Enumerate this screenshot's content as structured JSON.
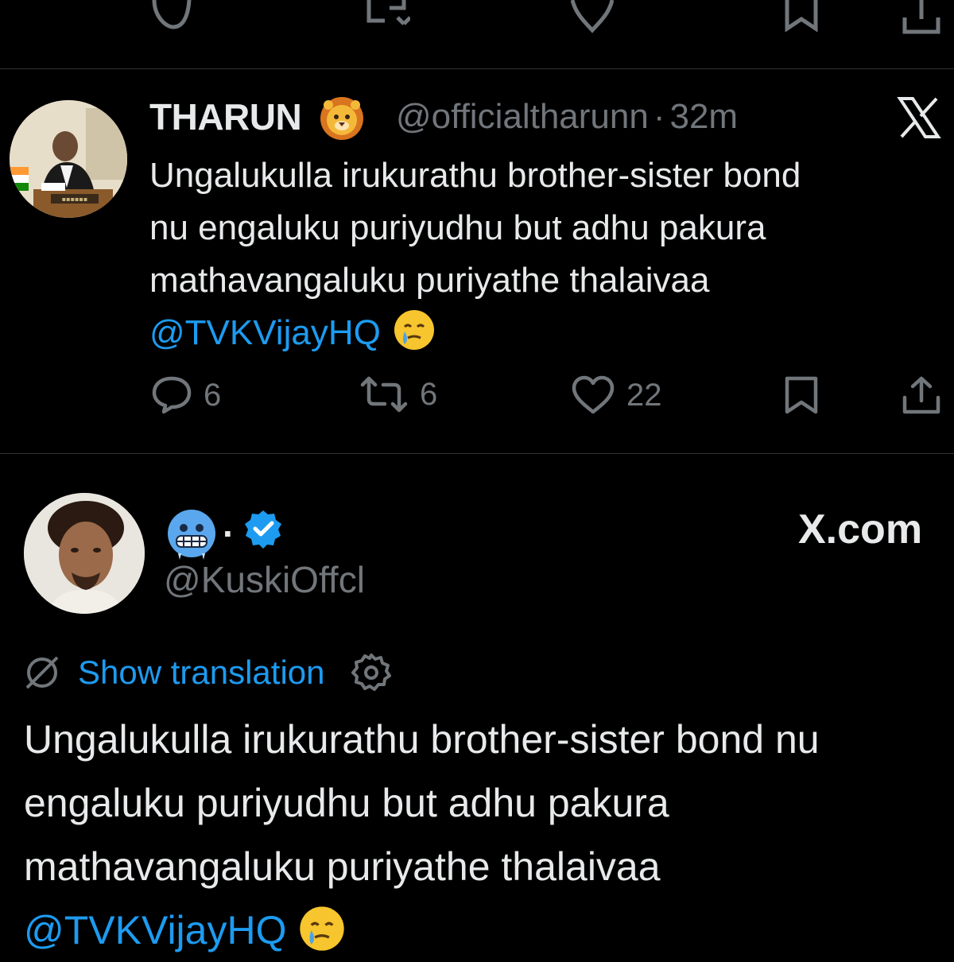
{
  "tweet1": {
    "display_name": "THARUN",
    "name_emoji": "lion-face-emoji",
    "handle": "@officialtharunn",
    "separator": "·",
    "time": "32m",
    "text_lines": [
      "Ungalukulla irukurathu brother-sister bond",
      "nu engaluku puriyudhu but adhu pakura",
      "mathavangaluku puriyathe thalaivaa"
    ],
    "mention": "@TVKVijayHQ",
    "trailing_emoji": "face-holding-back-tears-emoji",
    "actions": {
      "replies": "6",
      "retweets": "6",
      "likes": "22"
    }
  },
  "tweet2": {
    "name_emoji": "cold-face-emoji",
    "name_suffix": ".",
    "verified": true,
    "handle": "@KuskiOffcl",
    "watermark": "X.com",
    "translate_label": "Show translation",
    "text_lines": [
      "Ungalukulla irukurathu brother-sister bond nu",
      "engaluku puriyudhu but adhu pakura",
      "mathavangaluku puriyathe thalaivaa"
    ],
    "mention": "@TVKVijayHQ",
    "trailing_emoji": "face-holding-back-tears-emoji"
  },
  "colors": {
    "background": "#000000",
    "text": "#e7e9ea",
    "muted": "#71767b",
    "accent": "#1d9bf0",
    "divider": "#2f3336"
  }
}
